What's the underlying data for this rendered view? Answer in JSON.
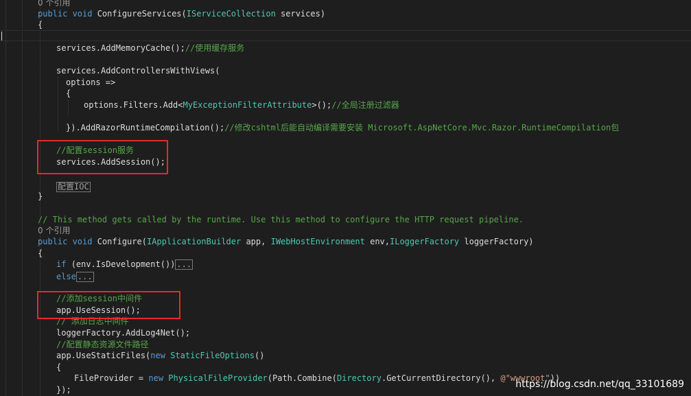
{
  "editor": {
    "refs1": "0 个引用",
    "refs2": "0 个引用",
    "l1": {
      "kw": "public void ",
      "name": "ConfigureServices",
      "open": "(",
      "type": "IServiceCollection",
      "rest": " services)"
    },
    "l2": "{",
    "l3": {
      "code": "services.AddMemoryCache();",
      "comment": "//使用缓存服务"
    },
    "l4": "services.AddControllersWithViews(",
    "l5": "options =>",
    "l6": "{",
    "l7": {
      "a": "options.Filters.Add<",
      "type": "MyExceptionFilterAttribute",
      "b": ">();",
      "comment": "//全局注册过滤器"
    },
    "l8": {
      "a": "}).AddRazorRuntimeCompilation();",
      "comment": "//修改cshtml后能自动编译需要安装 Microsoft.AspNetCore.Mvc.Razor.RuntimeCompilation包"
    },
    "l9": "//配置session服务",
    "l10": "services.AddSession();",
    "l11": "配置IOC",
    "l12": "}",
    "l13": "// This method gets called by the runtime. Use this method to configure the HTTP request pipeline.",
    "l14": {
      "kw": "public void ",
      "name": "Configure(",
      "t1": "IApplicationBuilder",
      "p1": " app, ",
      "t2": "IWebHostEnvironment",
      "p2": " env,",
      "t3": "ILoggerFactory",
      "p3": " loggerFactory)"
    },
    "l15": "{",
    "l16": {
      "kw": "if ",
      "rest": "(env.IsDevelopment())",
      "fold": "..."
    },
    "l17": {
      "kw": "else",
      "fold": "..."
    },
    "l18": "//添加session中间件",
    "l19": "app.UseSession();",
    "l20": "// 添加日志中间件",
    "l21": "loggerFactory.AddLog4Net();",
    "l22": "//配置静态资源文件路径",
    "l23": {
      "a": "app.UseStaticFiles(",
      "kw": "new ",
      "type": "StaticFileOptions",
      "b": "()"
    },
    "l24": "{",
    "l25": {
      "a": "FileProvider = ",
      "kw": "new ",
      "type": "PhysicalFileProvider",
      "b": "(Path.Combine(",
      "t2": "Directory",
      "c": ".GetCurrentDirectory(), ",
      "str": "@\"wwwroot\"",
      "d": "))"
    },
    "l26": "});"
  },
  "watermark": "https://blog.csdn.net/qq_33101689",
  "colors": {
    "background": "#1e1e1e",
    "keyword": "#569cd6",
    "type": "#4ec9b0",
    "comment": "#57a64a",
    "string": "#d69d85",
    "highlight_box": "#e8282b"
  }
}
